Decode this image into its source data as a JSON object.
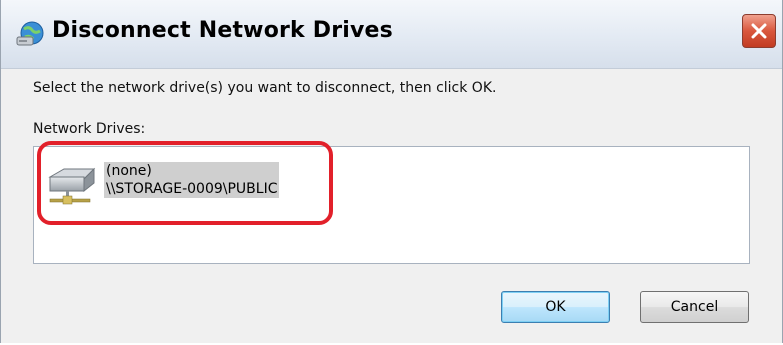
{
  "window": {
    "title": "Disconnect Network Drives",
    "title_icon": "network-drive-globe-icon",
    "close_icon": "close-icon"
  },
  "dialog": {
    "instruction": "Select the network drive(s) you want to disconnect, then click OK.",
    "list_label": "Network Drives:",
    "drives": [
      {
        "label": "(none)",
        "path": "\\\\STORAGE-0009\\PUBLIC",
        "icon": "network-drive-icon",
        "selected": true
      }
    ]
  },
  "buttons": {
    "ok": "OK",
    "cancel": "Cancel"
  },
  "annotation": {
    "highlight_color": "#e2202a"
  },
  "colors": {
    "selection_bg": "#cfcfcf",
    "close_button": "#d9573d"
  }
}
